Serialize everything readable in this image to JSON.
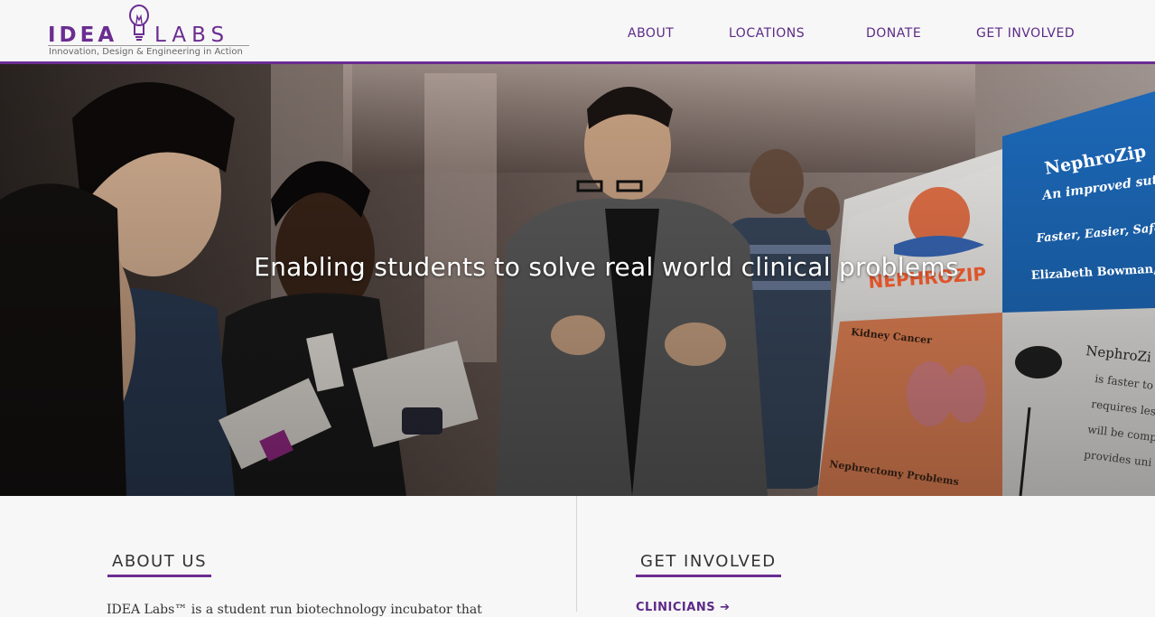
{
  "brand": {
    "logo_left": "IDEA",
    "logo_right": "LABS",
    "tagline": "Innovation, Design & Engineering in Action",
    "accent_color": "#6b2d91"
  },
  "nav": {
    "items": [
      {
        "label": "ABOUT"
      },
      {
        "label": "LOCATIONS"
      },
      {
        "label": "DONATE"
      },
      {
        "label": "GET INVOLVED"
      }
    ]
  },
  "hero": {
    "title": "Enabling students to solve real world clinical problems",
    "poster": {
      "headline": "NephroZip",
      "subtitle": "An improved sutu",
      "tagline": "Faster, Easier, Safer",
      "author": "Elizabeth Bowman,",
      "logo_text": "NEPHROZIP",
      "section1": "Kidney Cancer",
      "section2": "Nephrectomy Problems",
      "right_title": "NephroZi",
      "bullets": [
        "is faster to",
        "requires les",
        "will be comp",
        "provides uni"
      ]
    }
  },
  "about": {
    "heading": "ABOUT US",
    "text": "IDEA Labs™ is a student run biotechnology incubator that"
  },
  "get_involved": {
    "heading": "GET INVOLVED",
    "link": "CLINICIANS ➔"
  }
}
